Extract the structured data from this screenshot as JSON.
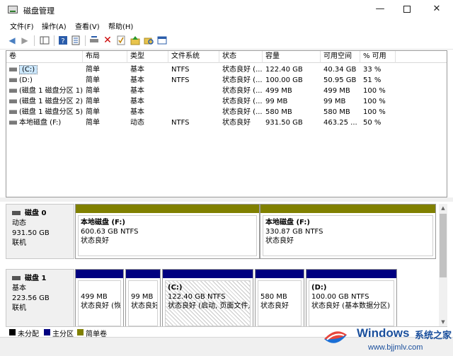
{
  "window": {
    "title": "磁盘管理",
    "minimize": "—",
    "close": "✕"
  },
  "menu": [
    "文件(F)",
    "操作(A)",
    "查看(V)",
    "帮助(H)"
  ],
  "toolbar": {
    "icons": [
      "back-arrow-icon",
      "forward-arrow-icon",
      "show-hide-tree-icon",
      "help-icon",
      "properties-icon",
      "connect-disk-icon",
      "delete-icon",
      "check-icon",
      "up-folder-icon",
      "search-folder-icon",
      "console-icon"
    ]
  },
  "volumes": {
    "columns": [
      "卷",
      "布局",
      "类型",
      "文件系统",
      "状态",
      "容量",
      "可用空间",
      "% 可用"
    ],
    "rows": [
      [
        "(C:)",
        "简单",
        "基本",
        "NTFS",
        "状态良好 (...",
        "122.40 GB",
        "40.34 GB",
        "33 %"
      ],
      [
        "(D:)",
        "简单",
        "基本",
        "NTFS",
        "状态良好 (...",
        "100.00 GB",
        "50.95 GB",
        "51 %"
      ],
      [
        "(磁盘 1 磁盘分区 1)",
        "简单",
        "基本",
        "",
        "状态良好 (...",
        "499 MB",
        "499 MB",
        "100 %"
      ],
      [
        "(磁盘 1 磁盘分区 2)",
        "简单",
        "基本",
        "",
        "状态良好 (...",
        "99 MB",
        "99 MB",
        "100 %"
      ],
      [
        "(磁盘 1 磁盘分区 5)",
        "简单",
        "基本",
        "",
        "状态良好 (...",
        "580 MB",
        "580 MB",
        "100 %"
      ],
      [
        "本地磁盘 (F:)",
        "简单",
        "动态",
        "NTFS",
        "状态良好",
        "931.50 GB",
        "463.25 ...",
        "50 %"
      ]
    ]
  },
  "disks": [
    {
      "name": "磁盘 0",
      "type": "动态",
      "size": "931.50 GB",
      "status": "联机",
      "partitions": [
        {
          "name": "本地磁盘 (F:)",
          "size": "600.63 GB NTFS",
          "status": "状态良好"
        },
        {
          "name": "本地磁盘 (F:)",
          "size": "330.87 GB NTFS",
          "status": "状态良好"
        }
      ]
    },
    {
      "name": "磁盘 1",
      "type": "基本",
      "size": "223.56 GB",
      "status": "联机",
      "partitions": [
        {
          "name": "",
          "size": "499 MB",
          "status": "状态良好 (恢"
        },
        {
          "name": "",
          "size": "99 MB",
          "status": "状态良好"
        },
        {
          "name": "(C:)",
          "size": "122.40 GB NTFS",
          "status": "状态良好 (启动, 页面文件,"
        },
        {
          "name": "",
          "size": "580 MB",
          "status": "状态良好"
        },
        {
          "name": "(D:)",
          "size": "100.00 GB NTFS",
          "status": "状态良好 (基本数据分区)"
        }
      ]
    }
  ],
  "legend": [
    {
      "label": "未分配",
      "color": "#000000"
    },
    {
      "label": "主分区",
      "color": "#000080"
    },
    {
      "label": "简单卷",
      "color": "#808000"
    }
  ],
  "watermark": {
    "brand": "Windows",
    "cn": "系统之家",
    "url": "www.bjjmlv.com"
  }
}
